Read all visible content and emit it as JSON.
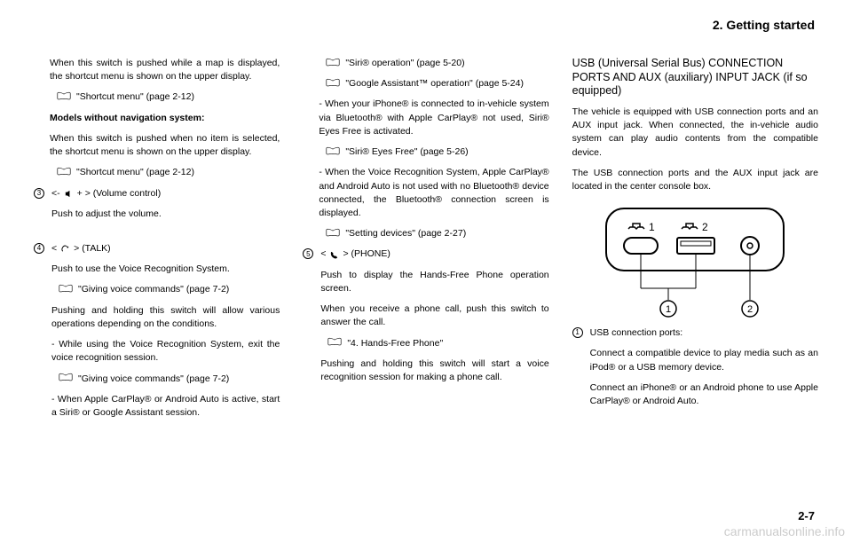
{
  "header": "2. Getting started",
  "col1": {
    "p1": "When this switch is pushed while a map is displayed, the shortcut menu is shown on the upper display.",
    "ref1": "\"Shortcut menu\" (page 2-12)",
    "p2": "Models without navigation system:",
    "p3": "When this switch is pushed when no item is selected, the shortcut menu is shown on the upper display.",
    "ref2": "\"Shortcut menu\" (page 2-12)",
    "item3_num": "3",
    "item3_label_a": "<-",
    "item3_label_b": "+ > (Volume control)",
    "item3_p1": "Push to adjust the volume.",
    "item4_num": "4",
    "item4_label_a": "<",
    "item4_label_b": "> (TALK)",
    "item4_p1": "Push to use the Voice Recognition System.",
    "item4_ref1": "\"Giving voice commands\" (page 7-2)",
    "item4_p2": "Pushing and holding this switch will allow various operations depending on the conditions.",
    "item4_p3": "- While using the Voice Recognition System, exit the voice recognition session.",
    "item4_ref2": "\"Giving voice commands\" (page 7-2)",
    "item4_p4": "- When Apple CarPlay® or Android Auto is active, start a Siri® or Google Assistant session."
  },
  "col2": {
    "ref1": "\"Siri® operation\" (page 5-20)",
    "ref2": "\"Google Assistant™ operation\" (page 5-24)",
    "p1": "- When your iPhone® is connected to in-vehicle system via Bluetooth® with Apple CarPlay® not used, Siri® Eyes Free is activated.",
    "ref3": "\"Siri® Eyes Free\" (page 5-26)",
    "p2": "- When the Voice Recognition System, Apple CarPlay® and Android Auto is not used with no Bluetooth® device connected, the Bluetooth® connection screen is displayed.",
    "ref4": "\"Setting devices\" (page 2-27)",
    "item5_num": "5",
    "item5_label_a": "<",
    "item5_label_b": "> (PHONE)",
    "item5_p1": "Push to display the Hands-Free Phone operation screen.",
    "item5_p2": "When you receive a phone call, push this switch to answer the call.",
    "item5_ref1": "\"4. Hands-Free Phone\"",
    "item5_p3": "Pushing and holding this switch will start a voice recognition session for making a phone call."
  },
  "col3": {
    "heading": "USB (Universal Serial Bus) CONNECTION PORTS AND AUX (auxiliary) INPUT JACK (if so equipped)",
    "p1": "The vehicle is equipped with USB connection ports and an AUX input jack. When connected, the in-vehicle audio system can play audio contents from the compatible device.",
    "p2": "The USB connection ports and the AUX input jack are located in the center console box.",
    "diagram_label1": "1",
    "diagram_label2": "2",
    "diagram_circ1": "1",
    "diagram_circ2": "2",
    "d1_label": "USB connection ports:",
    "d1_p1": "Connect a compatible device to play media such as an iPod® or a USB memory device.",
    "d1_p2": "Connect an iPhone® or an Android phone to use Apple CarPlay® or Android Auto."
  },
  "pageNum": "2-7",
  "watermark": "carmanualsonline.info"
}
